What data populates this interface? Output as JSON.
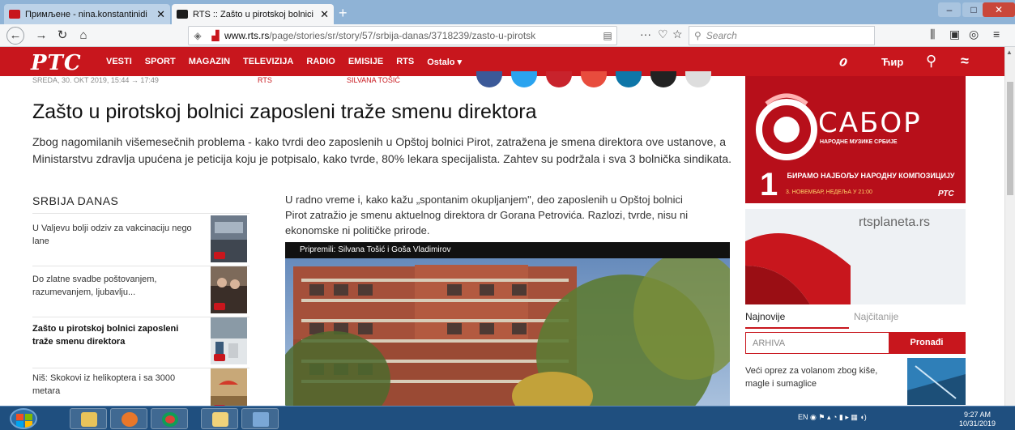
{
  "browser": {
    "tabs": [
      {
        "title": "Примљене - nina.konstantinidi",
        "close": "✕"
      },
      {
        "title": "RTS :: Zašto u pirotskoj bolnici",
        "close": "✕"
      }
    ],
    "new_tab": "+",
    "url_domain": "www.rts.rs",
    "url_path": "/page/stories/sr/story/57/srbija-danas/3718239/zasto-u-pirotsk",
    "search_placeholder": "Search",
    "toolbar_more": "···"
  },
  "site": {
    "logo": "РТС",
    "menu": [
      "VESTI",
      "SPORT",
      "MAGAZIN",
      "TELEVIZIJA",
      "RADIO",
      "EMISIJE",
      "RTS",
      "Ostalo ▾"
    ],
    "script_toggle": "Ћир"
  },
  "article": {
    "date": "SREDA, 30. OKT 2019, 15:44 → 17:49",
    "source": "RTS",
    "author": "SILVANA TOŠIĆ",
    "headline": "Zašto u pirotskoj bolnici zaposleni traže smenu direktora",
    "lead": "Zbog nagomilanih višemesečnih problema - kako tvrdi deo zaposlenih u Opštoj bolnici Pirot, zatražena je smena direktora ove ustanove, a Ministarstvu zdravlja upućena je peticija koju je potpisalo, kako tvrde, 80% lekara specijalista. Zahtev su podržala i sva 3 bolnička sindikata.",
    "body": "U radno vreme i, kako kažu „spontanim okupljanjem\", deo zaposlenih u Opštoj bolnici Pirot zatražio je smenu aktuelnog direktora dr Gorana Petrovića. Razlozi, tvrde, nisu ni ekonomske ni političke prirode.",
    "video_caption": "Pripremili: Silvana Tošić i Goša Vladimirov"
  },
  "sidebar_left": {
    "title": "SRBIJA DANAS",
    "stories": [
      {
        "text": "U Valjevu bolji odziv za vakcinaciju nego lane"
      },
      {
        "text": "Do zlatne svadbe poštovanjem, razumevanjem, ljubavlju..."
      },
      {
        "text": "Zašto u pirotskoj bolnici zaposleni traže smenu direktora"
      },
      {
        "text": "Niš: Skokovi iz helikoptera i sa 3000 metara"
      }
    ]
  },
  "sidebar_right": {
    "ad_sabor": {
      "title": "САБОР",
      "subtitle": "НАРОДНЕ МУЗИКЕ СРБИЈЕ",
      "number": "1",
      "vote": "БИРАМО НАЈБОЉУ НАРОДНУ КОМПОЗИЦИЈУ",
      "date": "3. НОВЕМБАР, НЕДЕЉА У 21:00",
      "brand": "РТС"
    },
    "ad_planeta": "rtsplaneta.rs",
    "tabs": [
      "Najnovije",
      "Najčitanije"
    ],
    "archive_placeholder": "ARHIVA",
    "archive_button": "Pronađi",
    "news": "Veći oprez za volanom zbog kiše, magle i sumaglice"
  },
  "taskbar": {
    "language": "EN",
    "time": "9:27 AM",
    "date": "10/31/2019"
  }
}
